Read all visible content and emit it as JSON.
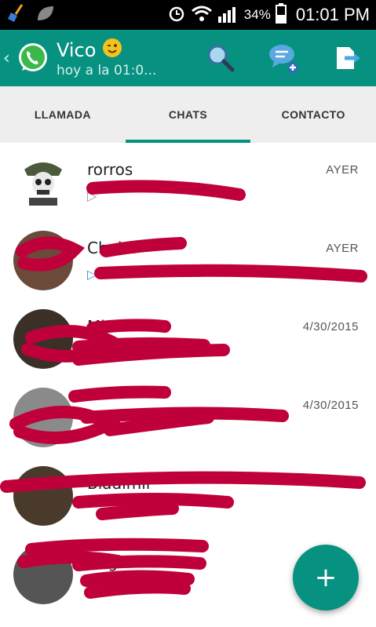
{
  "status_bar": {
    "battery_percent": "34%",
    "time": "01:01 PM"
  },
  "app_bar": {
    "contact_name": "Vico",
    "contact_subtitle": "hoy a la 01:0..."
  },
  "tabs": [
    {
      "label": "LLAMADA",
      "active": false
    },
    {
      "label": "CHATS",
      "active": true
    },
    {
      "label": "CONTACTO",
      "active": false
    }
  ],
  "chats": [
    {
      "name": "rorros",
      "time": "AYER"
    },
    {
      "name": "Cholul",
      "time": "AYER"
    },
    {
      "name": "Mi",
      "time": "4/30/2015"
    },
    {
      "name": "",
      "time": "4/30/2015"
    },
    {
      "name": "Bladimir",
      "time": ""
    },
    {
      "name": "Ang",
      "time": ""
    }
  ],
  "fab": {
    "label": "+"
  },
  "colors": {
    "primary": "#079180",
    "scribble": "#c0003b"
  }
}
